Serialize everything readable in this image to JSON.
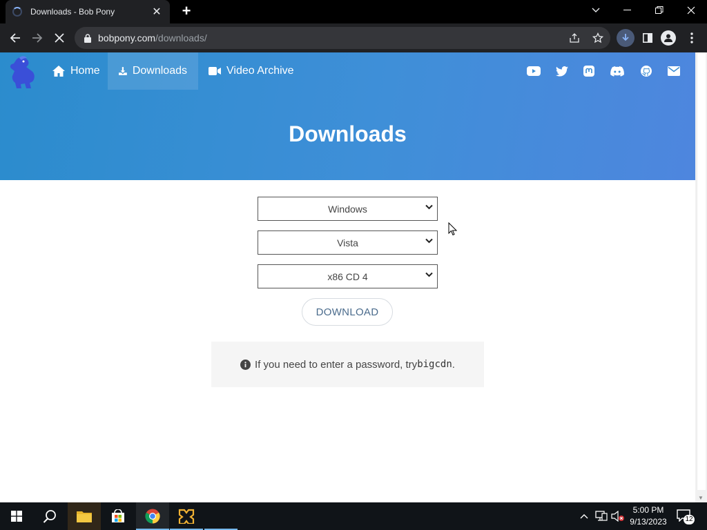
{
  "browser": {
    "tab_title": "Downloads - Bob Pony",
    "tab_close": "✕",
    "newtab": "+",
    "url_domain": "bobpony.com",
    "url_path": "/downloads/"
  },
  "nav": {
    "items": [
      {
        "label": "Home",
        "icon": "home-icon"
      },
      {
        "label": "Downloads",
        "icon": "download-icon"
      },
      {
        "label": "Video Archive",
        "icon": "video-icon"
      }
    ],
    "social_icons": [
      "youtube-icon",
      "twitter-icon",
      "mastodon-icon",
      "discord-icon",
      "github-icon",
      "mail-icon"
    ]
  },
  "hero": {
    "title": "Downloads"
  },
  "form": {
    "os_select": "Windows",
    "version_select": "Vista",
    "image_select": "x86 CD 4",
    "download_button": "DOWNLOAD"
  },
  "note": {
    "text": "If you need to enter a password, try ",
    "code": "bigcdn",
    "suffix": "."
  },
  "taskbar": {
    "time": "5:00 PM",
    "date": "9/13/2023",
    "notification_count": "12"
  },
  "colors": {
    "hero_start": "#2b8ccd",
    "hero_end": "#4e86de",
    "accent": "#4a6b8c"
  }
}
